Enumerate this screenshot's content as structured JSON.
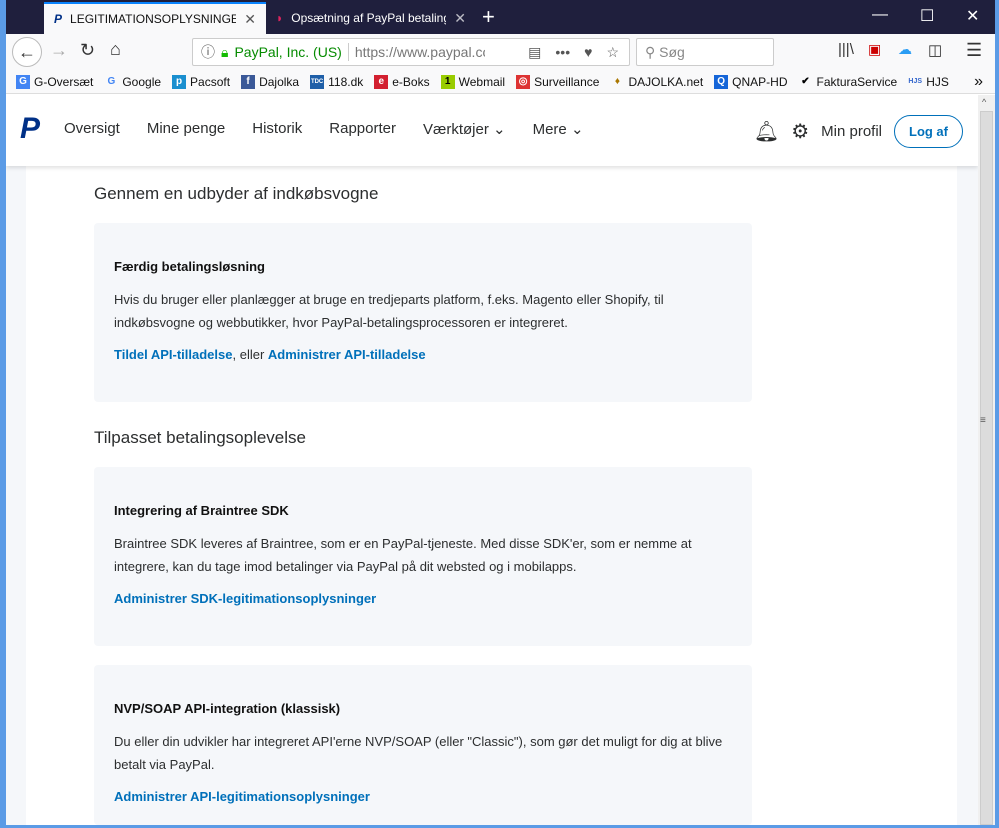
{
  "browser": {
    "tabs": [
      {
        "title": "LEGITIMATIONSOPLYSNINGER",
        "active": true
      },
      {
        "title": "Opsætning af PayPal betaling i",
        "active": false
      }
    ],
    "identity": "PayPal, Inc. (US)",
    "url": "https://www.paypal.co",
    "search_placeholder": "Søg",
    "bookmarks": [
      "G-Oversæt",
      "Google",
      "Pacsoft",
      "Dajolka",
      "118.dk",
      "e-Boks",
      "Webmail",
      "Surveillance",
      "DAJOLKA.net",
      "QNAP-HD",
      "FakturaService",
      "HJS"
    ]
  },
  "nav": {
    "items": [
      "Oversigt",
      "Mine penge",
      "Historik",
      "Rapporter",
      "Værktøjer",
      "Mere"
    ],
    "profile": "Min profil",
    "logout": "Log af"
  },
  "sections": [
    {
      "heading": "Gennem en udbyder af indkøbsvogne",
      "cards": [
        {
          "title": "Færdig betalingsløsning",
          "text": "Hvis du bruger eller planlægger at bruge en tredjeparts platform, f.eks. Magento eller Shopify, til indkøbsvogne og webbutikker, hvor PayPal-betalingsprocessoren er integreret.",
          "link1": "Tildel API-tilladelse",
          "joiner": ", eller ",
          "link2": "Administrer API-tilladelse"
        }
      ]
    },
    {
      "heading": "Tilpasset betalingsoplevelse",
      "cards": [
        {
          "title": "Integrering af Braintree SDK",
          "text": "Braintree SDK leveres af Braintree, som er en PayPal-tjeneste. Med disse SDK'er, som er nemme at integrere, kan du tage imod betalinger via PayPal på dit websted og i mobilapps.",
          "link1": "Administrer SDK-legitimationsoplysninger"
        },
        {
          "title": "NVP/SOAP API-integration (klassisk)",
          "text": "Du eller din udvikler har integreret API'erne NVP/SOAP (eller \"Classic\"), som gør det muligt for dig at blive betalt via PayPal.",
          "link1": "Administrer API-legitimationsoplysninger"
        }
      ]
    }
  ]
}
